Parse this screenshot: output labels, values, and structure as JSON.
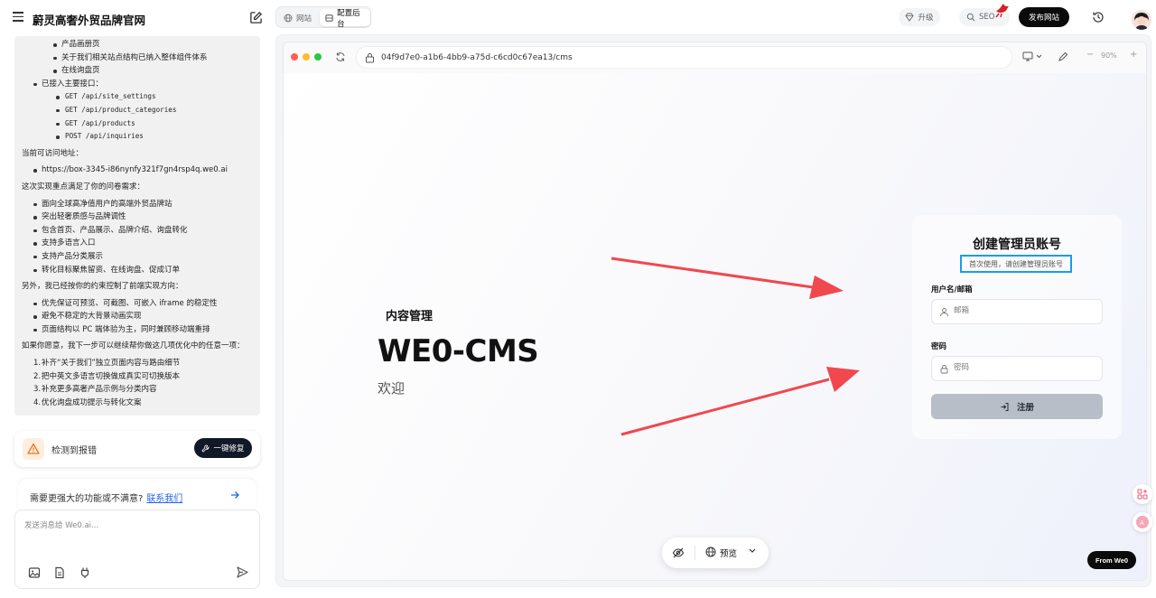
{
  "app": {
    "title": "蔚灵高奢外贸品牌官网"
  },
  "chat": {
    "sub_items": [
      "产品画册页",
      "关于我们相关站点结构已纳入整体组件体系",
      "在线询盘页"
    ],
    "api_heading": "已接入主要接口：",
    "apis": [
      "GET /api/site_settings",
      "GET /api/product_categories",
      "GET /api/products",
      "POST /api/inquiries"
    ],
    "url_heading": "当前可访问地址：",
    "url": "https://box-3345-i86nynfy321f7gn4rsp4q.we0.ai",
    "needs_heading": "这次实现重点满足了你的问卷需求：",
    "needs": [
      "面向全球高净值用户的高端外贸品牌站",
      "突出轻奢质感与品牌调性",
      "包含首页、产品展示、品牌介绍、询盘转化",
      "支持多语言入口",
      "支持产品分类展示",
      "转化目标聚焦留资、在线询盘、促成订单"
    ],
    "constraints_heading": "另外，我已经按你的约束控制了前端实现方向：",
    "constraints": [
      "优先保证可预览、可截图、可嵌入 iframe 的稳定性",
      "避免不稳定的大背景动画实现",
      "页面结构以 PC 端体验为主，同时兼顾移动端重排"
    ],
    "next_heading": "如果你愿意，我下一步可以继续帮你做这几项优化中的任意一项：",
    "next": [
      "补齐“关于我们”独立页面内容与路由细节",
      "把中英文多语言切换做成真实可切换版本",
      "补充更多高奢产品示例与分类内容",
      "优化询盘成功提示与转化文案"
    ]
  },
  "error_card": {
    "text": "检测到报错",
    "button": "一键修复"
  },
  "contact": {
    "text": "需要更强大的功能或不满意?",
    "link": "联系我们"
  },
  "composer": {
    "placeholder": "发送消息给 We0.ai..."
  },
  "topbar": {
    "tab_site": "网站",
    "tab_admin": "配置后台",
    "upgrade": "升级",
    "seo": "SEO",
    "publish": "发布网站"
  },
  "browser": {
    "url": "04f9d7e0-a1b6-4bb9-a75d-c6cd0c67ea13/cms",
    "zoom": "90%",
    "zoom_minus": "−",
    "zoom_plus": "+"
  },
  "cms": {
    "eyebrow": "内容管理",
    "title": "WE0-CMS",
    "welcome": "欢迎"
  },
  "login": {
    "title": "创建管理员账号",
    "subtitle": "首次使用，请创建管理员账号",
    "username_label": "用户名/邮箱",
    "username_placeholder": "邮箱",
    "password_label": "密码",
    "password_placeholder": "密码",
    "submit": "注册"
  },
  "preview_pill": {
    "label": "预览"
  },
  "badge": {
    "from": "From We0"
  },
  "colors": {
    "accent_blue": "#1e9bea",
    "arrow_red": "#f0484e",
    "dark": "#0b0b0b"
  }
}
